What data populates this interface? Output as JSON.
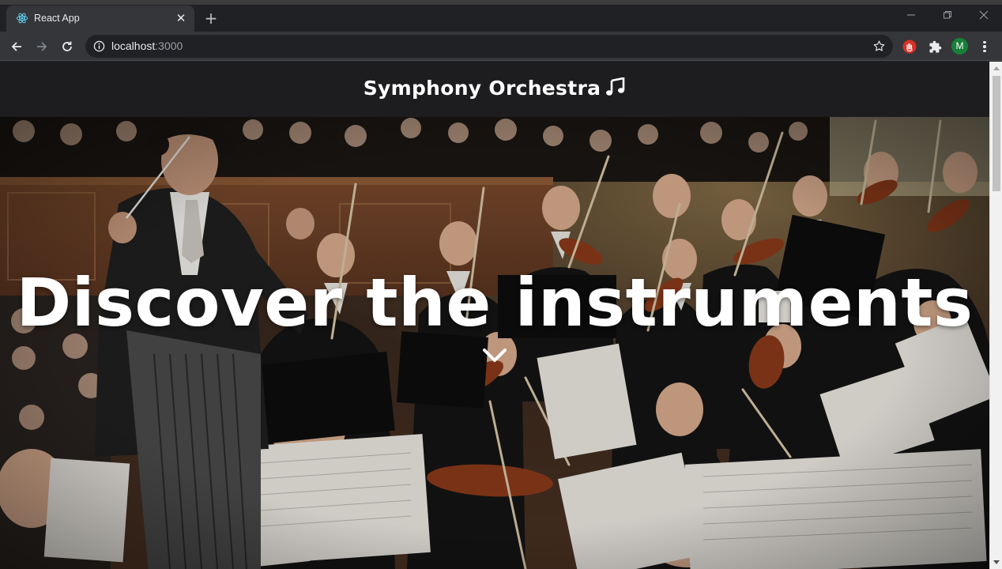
{
  "browser": {
    "tab": {
      "title": "React App",
      "favicon": "react-logo-icon",
      "close_icon": "close-icon"
    },
    "new_tab_icon": "plus-icon",
    "window_controls": [
      "minimize-icon",
      "restore-icon",
      "close-icon"
    ],
    "nav": [
      "back-arrow-icon",
      "forward-arrow-icon",
      "reload-icon"
    ],
    "address": {
      "host": "localhost",
      "port": ":3000",
      "info_icon": "info-icon",
      "bookmark_icon": "star-icon"
    },
    "extensions": [
      "red-hand-extension-icon",
      "puzzle-piece-icon"
    ],
    "profile_initial": "M",
    "menu_icon": "three-dots-vertical-icon"
  },
  "page": {
    "header": {
      "title": "Symphony Orchestra",
      "title_icon": "music-note-icon"
    },
    "hero": {
      "heading": "Discover the instruments",
      "scroll_icon": "chevron-down-icon"
    }
  },
  "colors": {
    "tab_strip": "#202124",
    "toolbar": "#35363a",
    "site_header": "#1d1d1f",
    "hero_text": "#ffffff",
    "avatar": "#188038"
  }
}
